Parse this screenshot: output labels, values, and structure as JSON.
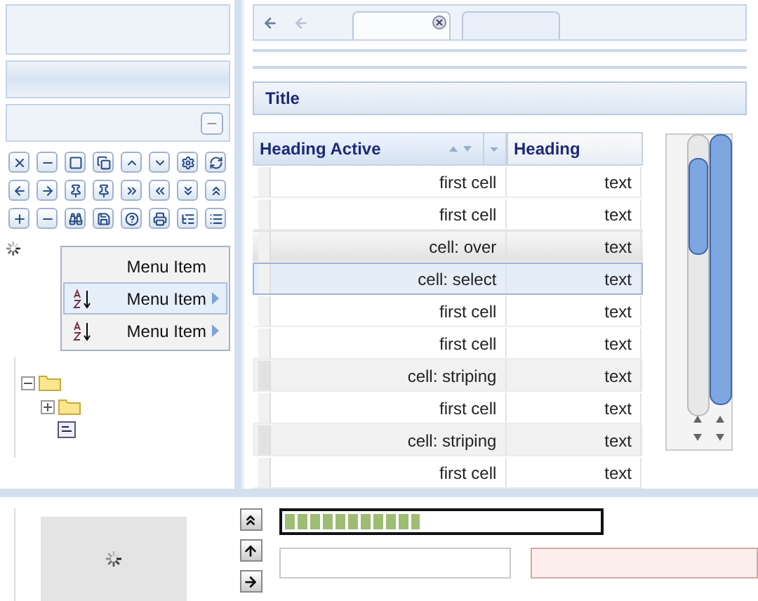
{
  "tabs": [
    {
      "selected": true,
      "closable": true
    },
    {
      "selected": false,
      "closable": false
    }
  ],
  "panel": {
    "title": "Title"
  },
  "menu": [
    {
      "label": "Menu Item",
      "sort_icon": false,
      "submenu": false,
      "selected": false
    },
    {
      "label": "Menu Item",
      "sort_icon": true,
      "submenu": true,
      "selected": true
    },
    {
      "label": "Menu Item",
      "sort_icon": true,
      "submenu": true,
      "selected": false
    }
  ],
  "tree": [
    {
      "kind": "folder",
      "expanded": true,
      "children": [
        {
          "kind": "folder",
          "expanded": false
        },
        {
          "kind": "file"
        }
      ]
    }
  ],
  "table": {
    "columns": [
      {
        "label": "Heading Active",
        "active": true
      },
      {
        "label": "Heading",
        "active": false
      }
    ],
    "rows": [
      {
        "cells": [
          "first cell",
          "text"
        ],
        "hover": false,
        "selected": false,
        "striped": false
      },
      {
        "cells": [
          "first cell",
          "text"
        ],
        "hover": false,
        "selected": false,
        "striped": false
      },
      {
        "cells": [
          "cell: over",
          "text"
        ],
        "hover": true,
        "selected": false,
        "striped": false
      },
      {
        "cells": [
          "cell: select",
          "text"
        ],
        "hover": false,
        "selected": true,
        "striped": false
      },
      {
        "cells": [
          "first cell",
          "text"
        ],
        "hover": false,
        "selected": false,
        "striped": false
      },
      {
        "cells": [
          "first cell",
          "text"
        ],
        "hover": false,
        "selected": false,
        "striped": false
      },
      {
        "cells": [
          "cell: striping",
          "text"
        ],
        "hover": false,
        "selected": false,
        "striped": true
      },
      {
        "cells": [
          "first cell",
          "text"
        ],
        "hover": false,
        "selected": false,
        "striped": false
      },
      {
        "cells": [
          "cell: striping",
          "text"
        ],
        "hover": false,
        "selected": false,
        "striped": true
      },
      {
        "cells": [
          "first cell",
          "text"
        ],
        "hover": false,
        "selected": false,
        "striped": false
      }
    ]
  },
  "progress": {
    "level": 0.43
  },
  "fields": [
    {
      "invalid": false
    },
    {
      "invalid": true
    }
  ]
}
